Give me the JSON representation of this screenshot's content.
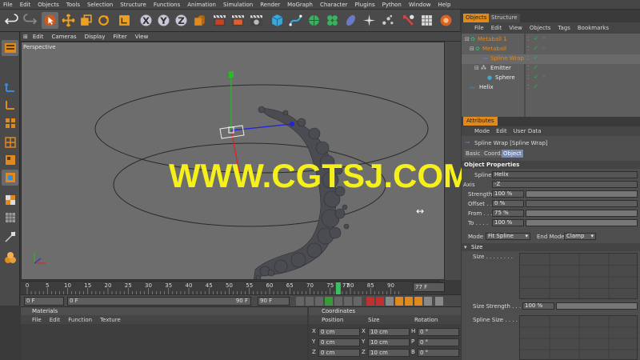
{
  "menubar": [
    "File",
    "Edit",
    "Objects",
    "Tools",
    "Selection",
    "Structure",
    "Functions",
    "Animation",
    "Simulation",
    "Render",
    "MoGraph",
    "Character",
    "Plugins",
    "Python",
    "Window",
    "Help"
  ],
  "viewport": {
    "menu": [
      "Edit",
      "Cameras",
      "Display",
      "Filter",
      "View"
    ],
    "label": "Perspective"
  },
  "timeline": {
    "ticks": [
      "0",
      "5",
      "10",
      "15",
      "20",
      "25",
      "30",
      "35",
      "40",
      "45",
      "50",
      "55",
      "60",
      "65",
      "70",
      "75",
      "80",
      "85",
      "90"
    ],
    "current_frame": "77",
    "frame_field": "77 F",
    "start_field": "0 F",
    "range_start": "0 F",
    "range_end": "90 F",
    "end_field": "90 F"
  },
  "materials": {
    "title": "Materials",
    "menu": [
      "File",
      "Edit",
      "Function",
      "Texture"
    ]
  },
  "coordinates": {
    "title": "Coordinates",
    "columns": [
      "Position",
      "Size",
      "Rotation"
    ],
    "rows": [
      {
        "axis": "X",
        "pos": "0 cm",
        "size_axis": "X",
        "size": "10 cm",
        "rot_axis": "H",
        "rot": "0 °"
      },
      {
        "axis": "Y",
        "pos": "0 cm",
        "size_axis": "Y",
        "size": "10 cm",
        "rot_axis": "P",
        "rot": "0 °"
      },
      {
        "axis": "Z",
        "pos": "0 cm",
        "size_axis": "Z",
        "size": "10 cm",
        "rot_axis": "B",
        "rot": "0 °"
      }
    ]
  },
  "object_manager": {
    "tabs": [
      "Objects",
      "Structure"
    ],
    "menu": [
      "File",
      "Edit",
      "View",
      "Objects",
      "Tags",
      "Bookmarks"
    ],
    "items": [
      "Metaball 1",
      "Metaball",
      "Spline Wrap",
      "Emitter",
      "Sphere",
      "Helix"
    ]
  },
  "attributes": {
    "title": "Attributes",
    "menu": [
      "Mode",
      "Edit",
      "User Data"
    ],
    "object_name": "Spline Wrap [Spline Wrap]",
    "tabs": [
      "Basic",
      "Coord.",
      "Object"
    ],
    "section": "Object Properties",
    "spline_label": "Spline",
    "spline_value": "Helix",
    "axis_label": "Axis",
    "axis_value": "-Z",
    "strength_label": "Strength",
    "strength_value": "100 %",
    "offset_label": "Offset . .",
    "offset_value": "0 %",
    "from_label": "From . . .",
    "from_value": "75 %",
    "to_label": "To . . . .",
    "to_value": "100 %",
    "mode_label": "Mode",
    "mode_value": "Fit Spline",
    "end_mode_label": "End Mode",
    "end_mode_value": "Clamp",
    "size_section": "Size",
    "size_label": "Size . . . . . . . .",
    "size_strength_label": "Size Strength . . .",
    "size_strength_value": "100 %",
    "spline_size_label": "Spline Size . . . . ."
  },
  "watermark": "WWW.CGTSJ.COM",
  "colors": {
    "accent_orange": "#e08a1e",
    "watermark_yellow": "#f5ef1a",
    "axis_x": "#e02020",
    "axis_y": "#20c020",
    "axis_z": "#2020e0"
  }
}
